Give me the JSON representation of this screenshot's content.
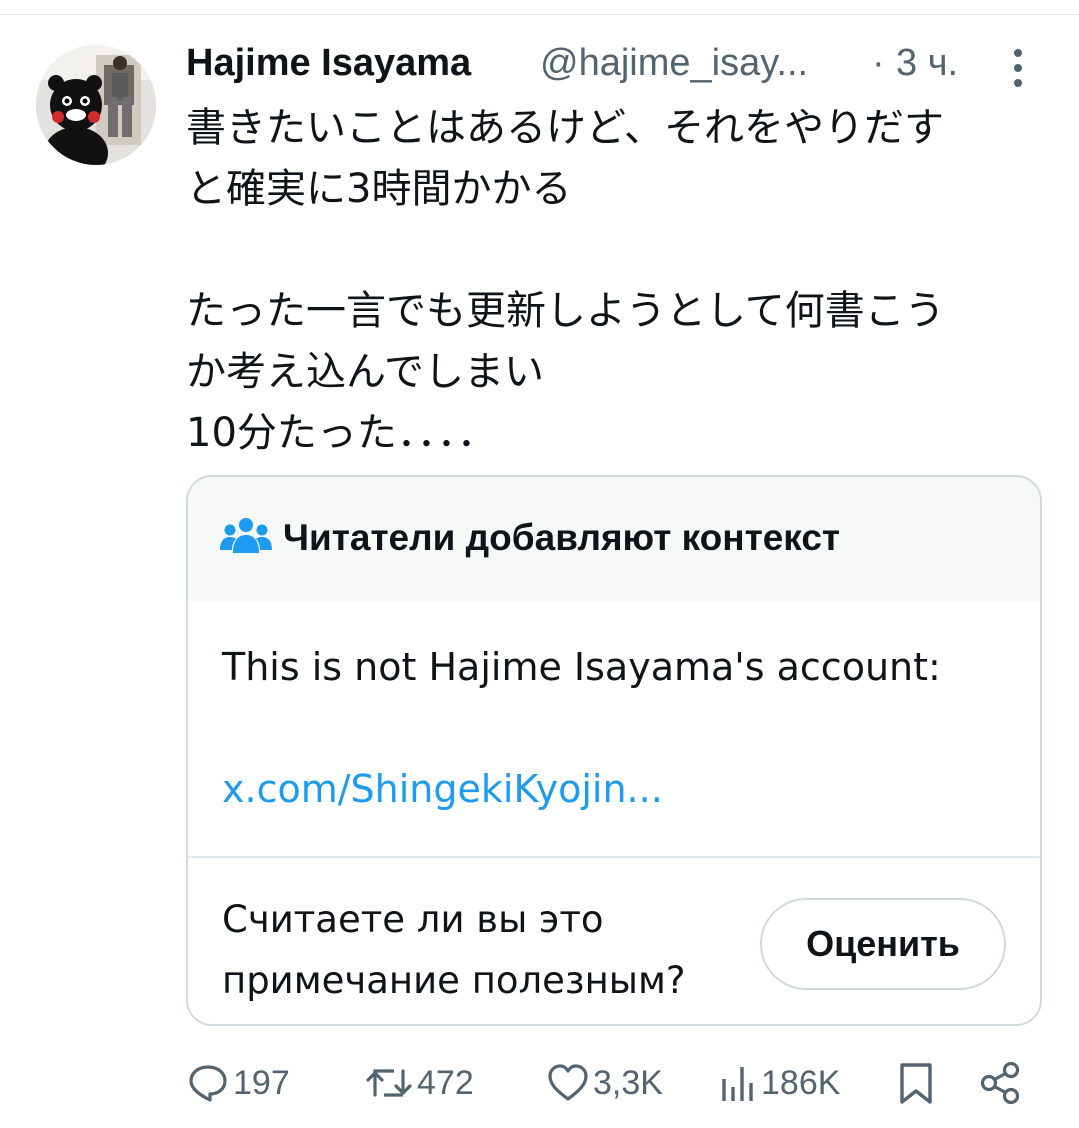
{
  "tweet": {
    "author": {
      "display_name": "Hajime Isayama",
      "handle": "@hajime_isay...",
      "avatar_icon": "avatar-photo"
    },
    "separator": "·",
    "time": "3 ч.",
    "more_icon": "more-vertical-icon",
    "text_lines": [
      "書きたいことはあるけど、それをやりだす",
      "と確実に3時間かかる",
      "",
      "たった一言でも更新しようとして何書こう",
      "か考え込んでしまい",
      "10分たった．．．．"
    ]
  },
  "community_note": {
    "title": "Читатели добавляют контекст",
    "title_icon": "people-icon",
    "body": "This is not Hajime Isayama's account:",
    "link": "x.com/ShingekiKyojin...",
    "question_lines": [
      "Считаете ли вы это",
      "примечание полезным?"
    ],
    "rate_button": "Оценить"
  },
  "actions": {
    "replies": "197",
    "reposts": "472",
    "likes": "3,3K",
    "views": "186K"
  },
  "colors": {
    "text": "#0f1419",
    "secondary": "#536471",
    "link": "#1d9bf0",
    "border": "#cfd9de",
    "note_header_bg": "#f7f9f9"
  }
}
